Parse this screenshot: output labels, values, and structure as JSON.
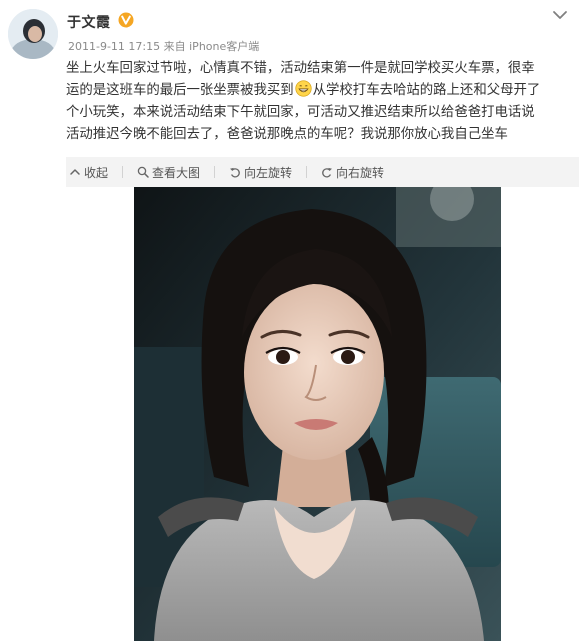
{
  "post": {
    "author": "于文霞",
    "verified": true,
    "timestamp": "2011-9-11 17:15",
    "source_prefix": "来自",
    "source": "iPhone客户端",
    "content_lines": [
      "坐上火车回家过节啦，心情真不错，活动结束第一件是就回学校买火车票，很幸",
      "运的是这班车的最后一张坐票被我买到",
      "从学校打车去哈站的路上还和父母开了",
      "个小玩笑，本来说活动结束下午就回家，可活动又推迟结束所以给爸爸打电话说",
      "活动推迟今晚不能回去了，爸爸说那晚点的车呢？我说那你放心我自己坐车"
    ]
  },
  "toolbar": {
    "collapse": "收起",
    "view_large": "查看大图",
    "rotate_left": "向左旋转",
    "rotate_right": "向右旋转"
  },
  "icons": {
    "verified_badge": "verified-v-icon",
    "menu": "chevron-down-icon",
    "emoji": "grin-emoji-icon",
    "collapse": "collapse-icon",
    "view_large": "zoom-icon",
    "rotate_left": "rotate-left-icon",
    "rotate_right": "rotate-right-icon"
  },
  "colors": {
    "text": "#333333",
    "meta": "#8a8a8a",
    "verified_badge": "#f5a623",
    "toolbar_bg": "#f3f3f3"
  }
}
